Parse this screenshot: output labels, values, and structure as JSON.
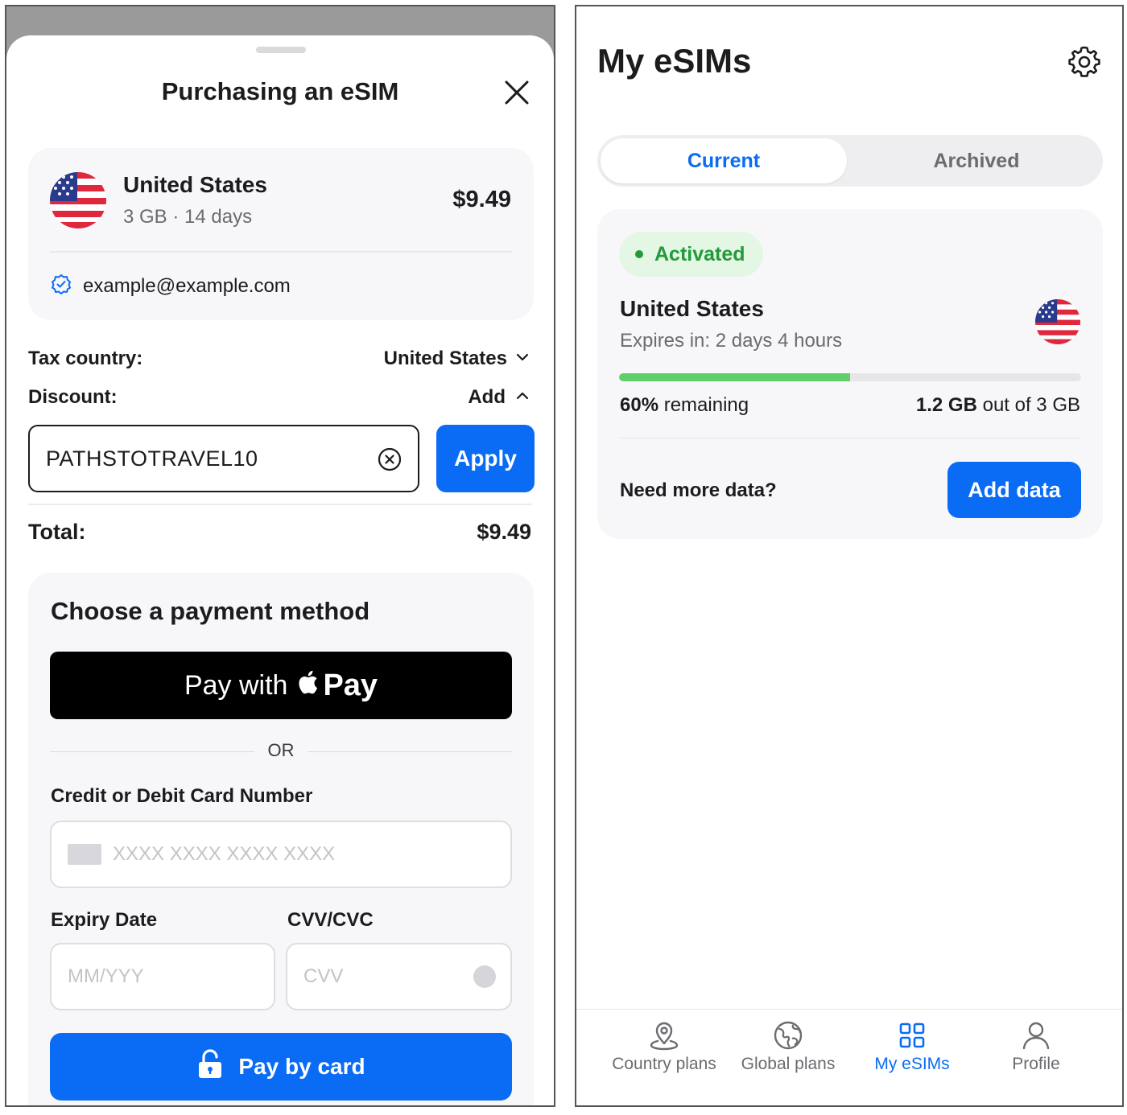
{
  "purchase": {
    "title": "Purchasing an eSIM",
    "summary": {
      "country": "United States",
      "plan": "3 GB · 14 days",
      "price": "$9.49",
      "email": "example@example.com"
    },
    "tax_country_label": "Tax country:",
    "tax_country_value": "United States",
    "discount_label": "Discount:",
    "discount_toggle": "Add",
    "discount_code": "PATHSTOTRAVEL10",
    "apply_label": "Apply",
    "total_label": "Total:",
    "total_value": "$9.49",
    "payment": {
      "title": "Choose a payment method",
      "apple_pay_prefix": "Pay with",
      "apple_pay_word": "Pay",
      "or_label": "OR",
      "card_number_label": "Credit or Debit Card Number",
      "card_number_placeholder": "XXXX XXXX XXXX XXXX",
      "expiry_label": "Expiry Date",
      "expiry_placeholder": "MM/YYY",
      "cvv_label": "CVV/CVC",
      "cvv_placeholder": "CVV",
      "pay_card_label": "Pay by card"
    }
  },
  "my_esims": {
    "title": "My eSIMs",
    "tabs": [
      {
        "label": "Current",
        "active": true
      },
      {
        "label": "Archived",
        "active": false
      }
    ],
    "esim": {
      "status": "Activated",
      "country": "United States",
      "expires": "Expires in: 2 days 4 hours",
      "remaining_fraction": 0.5,
      "remaining_pct": "60%",
      "remaining_text": "remaining",
      "used_amount": "1.2 GB",
      "used_suffix": "out of 3 GB",
      "need_more": "Need more data?",
      "add_data_label": "Add data"
    },
    "tabbar": [
      {
        "label": "Country plans",
        "icon": "map-pin-icon"
      },
      {
        "label": "Global plans",
        "icon": "globe-icon"
      },
      {
        "label": "My eSIMs",
        "icon": "grid-icon",
        "active": true
      },
      {
        "label": "Profile",
        "icon": "person-icon"
      }
    ]
  },
  "colors": {
    "accent": "#0a6cf5",
    "success": "#229a3a",
    "progress": "#5fcf6a"
  }
}
